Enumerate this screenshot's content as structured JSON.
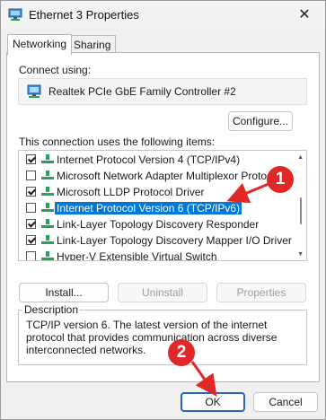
{
  "window": {
    "title": "Ethernet 3 Properties",
    "close_glyph": "✕"
  },
  "tabs": [
    {
      "label": "Networking",
      "active": true
    },
    {
      "label": "Sharing",
      "active": false
    }
  ],
  "connect_using": {
    "label": "Connect using:",
    "adapter": "Realtek PCIe GbE Family Controller #2"
  },
  "buttons": {
    "configure": "Configure...",
    "install": "Install...",
    "uninstall": "Uninstall",
    "properties": "Properties",
    "ok": "OK",
    "cancel": "Cancel"
  },
  "items_label": "This connection uses the following items:",
  "items": [
    {
      "label": "Internet Protocol Version 4 (TCP/IPv4)",
      "checked": true,
      "selected": false
    },
    {
      "label": "Microsoft Network Adapter Multiplexor Protocol",
      "checked": false,
      "selected": false
    },
    {
      "label": "Microsoft LLDP Protocol Driver",
      "checked": true,
      "selected": false
    },
    {
      "label": "Internet Protocol Version 6 (TCP/IPv6)",
      "checked": false,
      "selected": true
    },
    {
      "label": "Link-Layer Topology Discovery Responder",
      "checked": true,
      "selected": false
    },
    {
      "label": "Link-Layer Topology Discovery Mapper I/O Driver",
      "checked": true,
      "selected": false
    },
    {
      "label": "Hyper-V Extensible Virtual Switch",
      "checked": false,
      "selected": false
    }
  ],
  "description": {
    "legend": "Description",
    "text": "TCP/IP version 6. The latest version of the internet protocol that provides communication across diverse interconnected networks."
  },
  "annotations": [
    {
      "number": "1"
    },
    {
      "number": "2"
    }
  ],
  "colors": {
    "selection": "#0078d7",
    "annotation": "#e02828",
    "default_button_border": "#2a63c7"
  }
}
